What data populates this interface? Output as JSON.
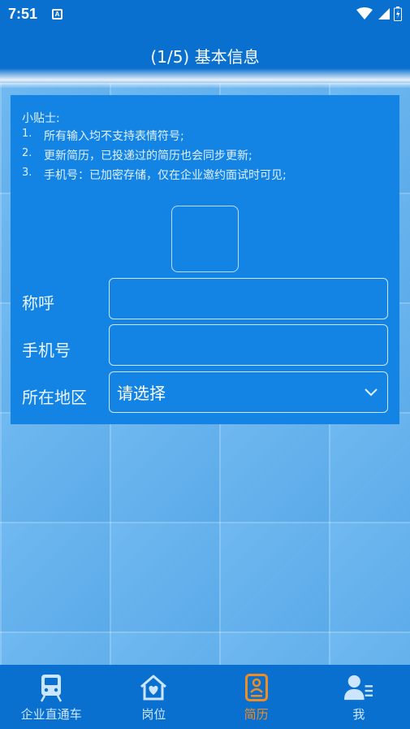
{
  "status_bar": {
    "time": "7:51",
    "notification_glyph": "A"
  },
  "header": {
    "title": "(1/5) 基本信息"
  },
  "tips": {
    "title": "小贴士:",
    "items": [
      {
        "num": "1.",
        "text": "所有输入均不支持表情符号;"
      },
      {
        "num": "2.",
        "text": "更新简历，已投递过的简历也会同步更新;"
      },
      {
        "num": "3.",
        "text": "手机号：已加密存储，仅在企业邀约面试时可见;"
      }
    ]
  },
  "form": {
    "name_label": "称呼",
    "name_value": "",
    "phone_label": "手机号",
    "phone_value": "",
    "region_label": "所在地区",
    "region_value": "请选择"
  },
  "bottom_nav": {
    "items": [
      {
        "label": "企业直通车",
        "icon": "train-icon",
        "active": false
      },
      {
        "label": "岗位",
        "icon": "home-heart-icon",
        "active": false
      },
      {
        "label": "简历",
        "icon": "resume-icon",
        "active": true
      },
      {
        "label": "我",
        "icon": "profile-icon",
        "active": false
      }
    ]
  },
  "colors": {
    "primary": "#0a70cf",
    "panel": "#1384e4",
    "background": "#60b1ef",
    "active_tab": "#f28c1e",
    "inactive_tab": "#cde6ff"
  }
}
